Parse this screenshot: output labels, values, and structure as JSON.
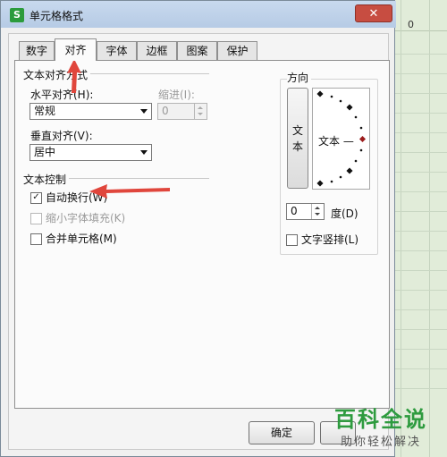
{
  "window": {
    "title": "单元格格式",
    "app_icon": "S",
    "close_symbol": "✕"
  },
  "tabs": [
    {
      "label": "数字",
      "active": false
    },
    {
      "label": "对齐",
      "active": true
    },
    {
      "label": "字体",
      "active": false
    },
    {
      "label": "边框",
      "active": false
    },
    {
      "label": "图案",
      "active": false
    },
    {
      "label": "保护",
      "active": false
    }
  ],
  "text_alignment": {
    "section_title": "文本对齐方式",
    "horizontal_label": "水平对齐(H):",
    "horizontal_value": "常规",
    "indent_label": "缩进(I):",
    "indent_value": "0",
    "vertical_label": "垂直对齐(V):",
    "vertical_value": "居中"
  },
  "text_control": {
    "section_title": "文本控制",
    "wrap_text": {
      "label": "自动换行(W)",
      "checked": true
    },
    "shrink_to_fit": {
      "label": "缩小字体填充(K)",
      "checked": false,
      "disabled": true
    },
    "merge_cells": {
      "label": "合并单元格(M)",
      "checked": false
    }
  },
  "orientation": {
    "section_title": "方向",
    "vertical_text_char1": "文",
    "vertical_text_char2": "本",
    "dial_text": "文本 —",
    "degree_value": "0",
    "degree_label": "度(D)",
    "vertical_text_checkbox": {
      "label": "文字竖排(L)",
      "checked": false
    },
    "accent_color": "#9b1c1c"
  },
  "buttons": {
    "ok": "确定"
  },
  "spreadsheet": {
    "column_number": "0"
  },
  "watermark": {
    "title": "百科全说",
    "subtitle": "助你轻松解决"
  },
  "annotation_color": "#e0463c"
}
